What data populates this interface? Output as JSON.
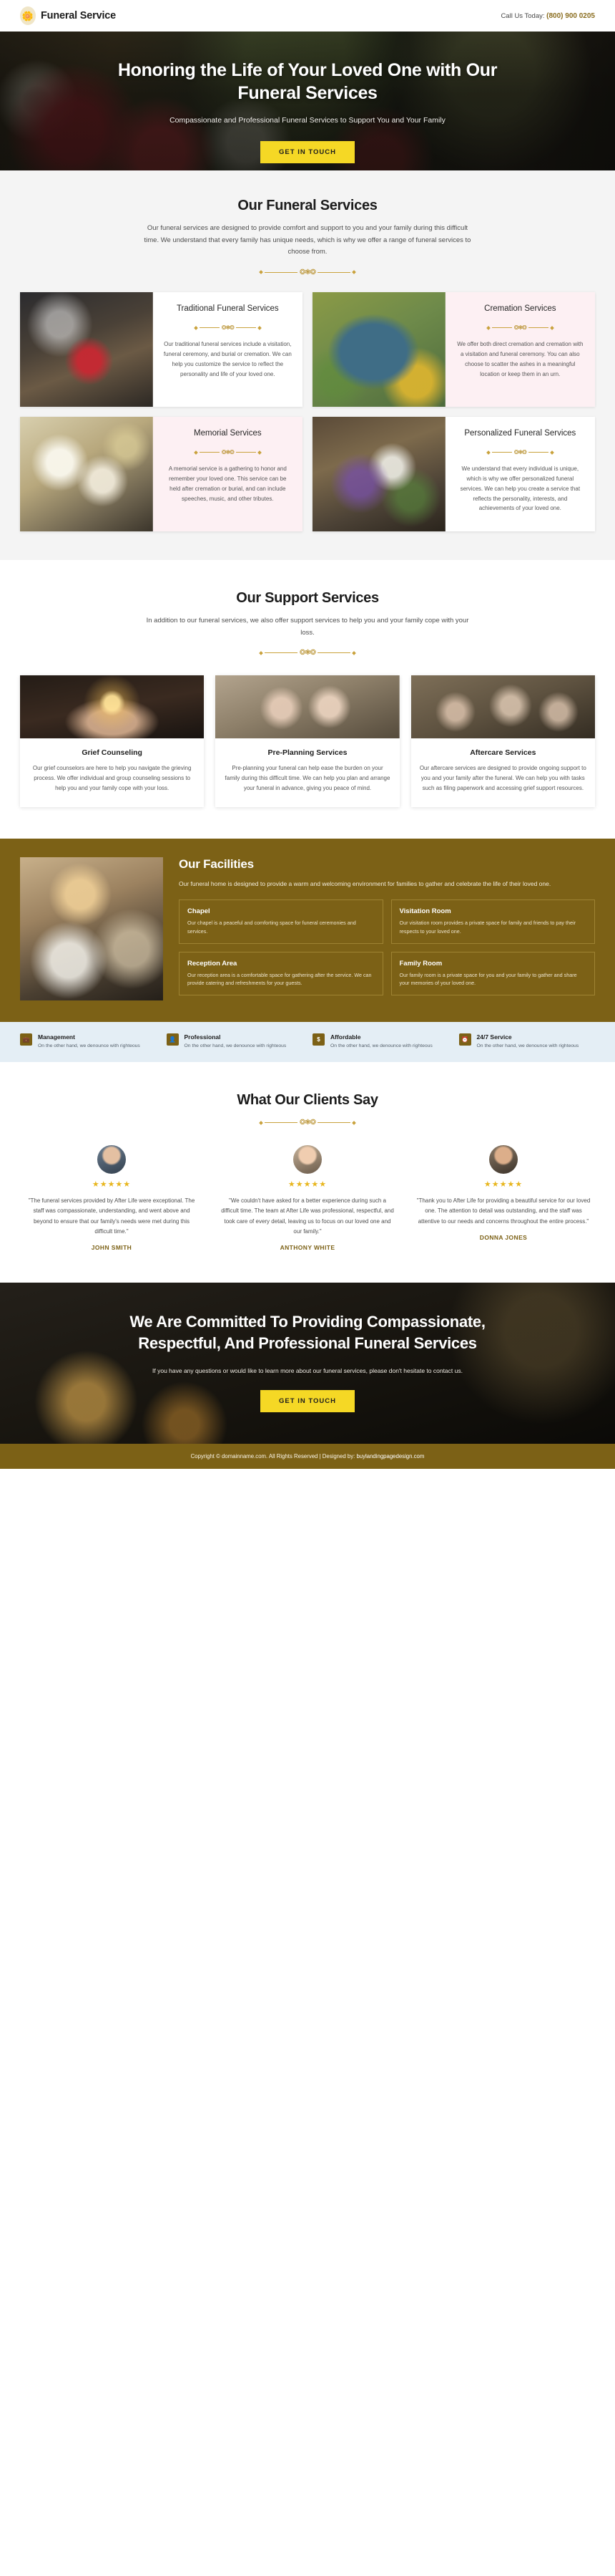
{
  "header": {
    "brand_icon": "bouquet-icon",
    "brand_name": "Funeral Service",
    "call_label": "Call Us Today:",
    "phone": "(800) 900 0205"
  },
  "hero": {
    "title": "Honoring the Life of Your Loved One with Our Funeral Services",
    "subtitle": "Compassionate and Professional Funeral Services to Support You and Your Family",
    "cta_label": "GET IN TOUCH"
  },
  "funeral_services": {
    "title": "Our Funeral Services",
    "description": "Our funeral services are designed to provide comfort and support to you and your family during this difficult time. We understand that every family has unique needs, which is why we offer a range of funeral services to choose from.",
    "cards": [
      {
        "title": "Traditional Funeral Services",
        "text": "Our traditional funeral services include a visitation, funeral ceremony, and burial or cremation. We can help you customize the service to reflect the personality and life of your loved one."
      },
      {
        "title": "Cremation Services",
        "text": "We offer both direct cremation and cremation with a visitation and funeral ceremony. You can also choose to scatter the ashes in a meaningful location or keep them in an urn."
      },
      {
        "title": "Memorial Services",
        "text": "A memorial service is a gathering to honor and remember your loved one. This service can be held after cremation or burial, and can include speeches, music, and other tributes."
      },
      {
        "title": "Personalized Funeral Services",
        "text": "We understand that every individual is unique, which is why we offer personalized funeral services. We can help you create a service that reflects the personality, interests, and achievements of your loved one."
      }
    ]
  },
  "support_services": {
    "title": "Our Support Services",
    "description": "In addition to our funeral services, we also offer support services to help you and your family cope with your loss.",
    "cards": [
      {
        "title": "Grief Counseling",
        "text": "Our grief counselors are here to help you navigate the grieving process. We offer individual and group counseling sessions to help you and your family cope with your loss."
      },
      {
        "title": "Pre-Planning Services",
        "text": "Pre-planning your funeral can help ease the burden on your family during this difficult time. We can help you plan and arrange your funeral in advance, giving you peace of mind."
      },
      {
        "title": "Aftercare Services",
        "text": "Our aftercare services are designed to provide ongoing support to you and your family after the funeral. We can help you with tasks such as filing paperwork and accessing grief support resources."
      }
    ]
  },
  "facilities": {
    "title": "Our Facilities",
    "description": "Our funeral home is designed to provide a warm and welcoming environment for families to gather and celebrate the life of their loved one.",
    "items": [
      {
        "title": "Chapel",
        "text": "Our chapel is a peaceful and comforting space for funeral ceremonies and services."
      },
      {
        "title": "Visitation Room",
        "text": "Our visitation room provides a private space for family and friends to pay their respects to your loved one."
      },
      {
        "title": "Reception Area",
        "text": "Our reception area is a comfortable space for gathering after the service. We can provide catering and refreshments for your guests."
      },
      {
        "title": "Family Room",
        "text": "Our family room is a private space for you and your family to gather and share your memories of your loved one."
      }
    ]
  },
  "features": [
    {
      "icon": "briefcase-icon",
      "title": "Management",
      "text": "On the other hand, we denounce with righteous"
    },
    {
      "icon": "user-tie-icon",
      "title": "Professional",
      "text": "On the other hand, we denounce with righteous"
    },
    {
      "icon": "dollar-icon",
      "title": "Affordable",
      "text": "On the other hand, we denounce with righteous"
    },
    {
      "icon": "clock-icon",
      "title": "24/7 Service",
      "text": "On the other hand, we denounce with righteous"
    }
  ],
  "testimonials": {
    "title": "What Our Clients Say",
    "items": [
      {
        "avatar": "avatar-male-suit",
        "rating": "4.5",
        "stars": "★★★★★",
        "quote": "\"The funeral services provided by After Life were exceptional. The staff was compassionate, understanding, and went above and beyond to ensure that our family's needs were met during this difficult time.\"",
        "name": "JOHN SMITH"
      },
      {
        "avatar": "avatar-female",
        "rating": "4.5",
        "stars": "★★★★★",
        "quote": "\"We couldn't have asked for a better experience during such a difficult time. The team at After Life was professional, respectful, and took care of every detail, leaving us to focus on our loved one and our family.\"",
        "name": "ANTHONY WHITE"
      },
      {
        "avatar": "avatar-male-beard",
        "rating": "4.5",
        "stars": "★★★★★",
        "quote": "\"Thank you to After Life for providing a beautiful service for our loved one. The attention to detail was outstanding, and the staff was attentive to our needs and concerns throughout the entire process.\"",
        "name": "DONNA JONES"
      }
    ]
  },
  "cta": {
    "title": "We Are Committed To Providing Compassionate, Respectful, And Professional Funeral Services",
    "text": "If you have any questions or would like to learn more about our funeral services, please don't hesitate to contact us.",
    "button_label": "GET IN TOUCH"
  },
  "footer": {
    "copyright": "Copyright © domainname.com. All Rights Reserved | Designed by: ",
    "link": "buylandingpagedesign.com"
  },
  "colors": {
    "gold": "#7c6116",
    "yellow": "#f5d825",
    "ornament": "#c9a23c",
    "pink_panel": "#fdf0f3",
    "feature_strip": "#e4eef5"
  }
}
